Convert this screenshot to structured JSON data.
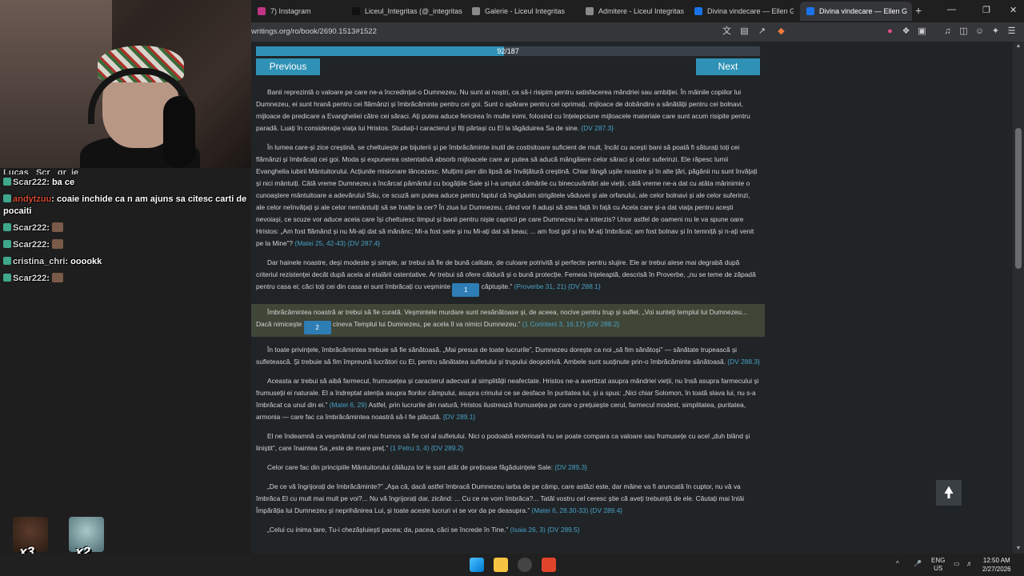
{
  "browser": {
    "tabs": [
      {
        "label": "7) Instagram",
        "fav": "#c13584"
      },
      {
        "label": "Liceul_Integritas (@_integritas_",
        "fav": "#111111"
      },
      {
        "label": "Galerie - Liceul Integritas",
        "fav": "#8a8a8a"
      },
      {
        "label": "Admitere - Liceul Integritas",
        "fav": "#8a8a8a"
      },
      {
        "label": "Divina vindecare — Ellen G. W",
        "fav": "#1a73e8"
      },
      {
        "label": "Divina vindecare — Ellen G",
        "fav": "#1a73e8"
      }
    ],
    "url": "writings.org/ro/book/2690.1513#1522"
  },
  "reader": {
    "progress_label": "92/187",
    "progress_fraction": 0.492,
    "prev_label": "Previous",
    "next_label": "Next",
    "paragraphs": [
      {
        "text": "Banii reprezintă o valoare pe care ne-a încredințat-o Dumnezeu. Nu sunt ai noștri, ca să-i risipim pentru satisfacerea mândriei sau ambiției. În mâinile copiilor lui Dumnezeu, ei sunt hrană pentru cei flămânzi și îmbrăcăminte pentru cei goi. Sunt o apărare pentru cei oprimați, mijloace de dobândire a sănătății pentru cei bolnavi, mijloace de predicare a Evangheliei către cei săraci. Ați putea aduce fericirea în multe inimi, folosind cu înțelepciune mijloacele materiale care sunt acum risipite pentru paradă. Luați în considerație viața lui Hristos. Studiați-I caracterul și fiți părtași cu El la tăgăduirea Sa de sine.",
        "refs": [
          "{DV 287.3}"
        ]
      },
      {
        "text": "În lumea care-și zice creștină, se cheltuiește pe bijuterii și pe îmbrăcăminte inutil de costisitoare suficient de mult, încât cu acești bani să poată fi săturați toți cei flămânzi și îmbrăcați cei goi. Moda și expunerea ostentativă absorb mijloacele care ar putea să aducă mângâiere celor săraci și celor suferinzi. Ele răpesc lumii Evanghelia iubirii Mântuitorului. Acțiunile misionare lâncezesc. Mulțimi pier din lipsă de învățătură creștină. Chiar lângă ușile noastre și în alte țări, păgânii nu sunt învățați și nici mântuiți. Câtă vreme Dumnezeu a încărcat pământul cu bogățiile Sale și l-a umplut cămările cu binecuvântări ale vieții, câtă vreme ne-a dat cu atâta mărinimie o cunoaștere mântuitoare a adevărului Său, ce scuză am putea aduce pentru faptul că îngăduim strigătele văduvei și ale orfanului, ale celor bolnavi și ale celor suferinzi, ale celor neînvățați și ale celor nemântuiți să se înalțe la cer? În ziua lui Dumnezeu, când vor fi aduși să stea față în față cu Acela care și-a dat viața pentru acești nevoiași, ce scuze vor aduce aceia care își cheltuiesc timpul și banii pentru niște capricii pe care Dumnezeu le-a interzis? Unor astfel de oameni nu le va spune oare Hristos: „Am fost flămând și nu Mi-ați dat să mănânc; Mi-a fost sete și nu Mi-ați dat să beau; ... am fost gol și nu M-ați îmbrăcat; am fost bolnav și în temniță și n-ați venit pe la Mine”?",
        "refs": [
          "(Matei 25, 42-43)",
          "{DV 287.4}"
        ]
      },
      {
        "text_a": "Dar hainele noastre, deși modeste și simple, ar trebui să fie de bună calitate, de culoare potrivită și perfecte pentru slujire. Ele ar trebui alese mai degrabă după criteriul rezistenței decât după acela al etalării ostentative. Ar trebui să ofere căldură și o bună protecție. Femeia înțeleaptă, descrisă în Proverbe, „nu se teme de zăpadă pentru casa ei; căci toți cei din casa ei sunt îmbrăcați cu veșminte",
        "mark": "1",
        "text_b": "căptușite.”",
        "refs": [
          "(Proverbe 31, 21)",
          "{DV 288.1}"
        ]
      },
      {
        "text_a": "Îmbrăcămintea noastră ar trebui să fie curată. Veșmintele murdare sunt nesănătoase și, de aceea, nocive pentru trup și suflet. „Voi sunteți templul lui Dumnezeu... Dacă nimicește",
        "mark": "2",
        "text_b": "cineva Templul lui Dumnezeu, pe acela îl va nimici Dumnezeu.”",
        "refs": [
          "(1 Corinteni 3, 16.17)",
          "{DV 288.2}"
        ]
      },
      {
        "text": "În toate privințele, îmbrăcămintea trebuie să fie sănătoasă. „Mai presus de toate lucrurile”, Dumnezeu dorește ca noi „să fim sănătoși” — sănătate trupească și sufletească. Și trebuie să fim împreună lucrători cu El, pentru sănătatea sufletului și trupului deopotrivă. Ambele sunt susținute prin-o îmbrăcăminte sănătoasă.",
        "refs": [
          "{DV 288.3}"
        ]
      },
      {
        "text": "Aceasta ar trebui să aibă farmecul, frumusețea și caracterul adecvat al simplității neafectate. Hristos ne-a avertizat asupra mândriei vieții, nu însă asupra farmecului și frumuseții ei naturale. El a îndreptat atenția asupra florilor câmpului, asupra crinului ce se desface în puritatea lui, și a spus: „Nici chiar Solomon, în toată slava lui, nu s-a îmbrăcat ca unul din ei.”",
        "refs": [
          "(Matei 6, 29)",
          "Astfel, prin lucrurile din natură, Hristos ilustrează frumusețea pe care o prețuiește cerul, farmecul modest, simplitatea, puritatea, armonia — care fac ca îmbrăcămintea noastră să-I fie plăcută.",
          "{DV 289.1}"
        ]
      },
      {
        "text": "El ne îndeamnă ca veșmântul cel mai frumos să fie cel al sufletului. Nici o podoabă exterioară nu se poate compara ca valoare sau frumusețe cu acel „duh blând și liniștit”, care înaintea Sa „este de mare preț.”",
        "refs": [
          "(1 Petru 3, 4)",
          "{DV 289.2}"
        ]
      },
      {
        "text": "Celor care fac din principiile Mântuitorului călăuza lor le sunt atât de prețioase făgăduințele Sale:",
        "refs": [
          "{DV 289.3}"
        ]
      },
      {
        "text": "„De ce vă îngrijorați de îmbrăcăminte?” „Așa că, dacă astfel îmbracă Dumnezeu iarba de pe câmp, care astăzi este, dar mâine va fi aruncată în cuptor, nu vă va îmbrăca El cu mult mai mult pe voi?... Nu vă îngrijorați dar, zicând: ... Cu ce ne vom îmbrăca?... Tatăl vostru cel ceresc știe că aveți trebuință de ele. Căutați mai întâi Împărăția lui Dumnezeu și neprihănirea Lui, și toate aceste lucruri vi se vor da pe deasupra.”",
        "refs": [
          "(Matei 6, 28.30-33)",
          "{DV 289.4}"
        ]
      },
      {
        "text": "„Celui cu inima tare, Tu-i chezășluiești pacea; da, pacea, căci se încrede în Tine.”",
        "refs": [
          "(Isaia 26, 3)",
          "{DV 289.5}"
        ]
      }
    ]
  },
  "chat": {
    "lines": [
      {
        "type": "cut",
        "text": "Lucas_ Scr_ gr_je"
      },
      {
        "name": "Scar222",
        "name_color": "#d9d9d9",
        "msg": "ba ce"
      },
      {
        "name": "andytzuu",
        "name_color": "#d24a32",
        "msg": "coaie inchide ca n am ajuns sa citesc carti de pocaiti"
      },
      {
        "name": "Scar222",
        "name_color": "#d9d9d9",
        "msg": "",
        "emote": true
      },
      {
        "name": "Scar222",
        "name_color": "#d9d9d9",
        "msg": "",
        "emote": true
      },
      {
        "name": "cristina_chri",
        "name_color": "#d9d9d9",
        "msg": "ooookk"
      },
      {
        "name": "Scar222",
        "name_color": "#d9d9d9",
        "msg": "",
        "emote": true
      }
    ],
    "emote_counts": [
      "x3",
      "x2"
    ]
  },
  "taskbar": {
    "lang": "ENG",
    "region": "US",
    "time": "12:50 AM",
    "date": "2/27/2026"
  },
  "icons": [
    "translate-icon",
    "reader-icon",
    "share-icon",
    "brave-shield-icon",
    "extensions-icon",
    "sidebar-icon",
    "profile-icon",
    "menu-icon",
    "back-to-top-icon"
  ]
}
